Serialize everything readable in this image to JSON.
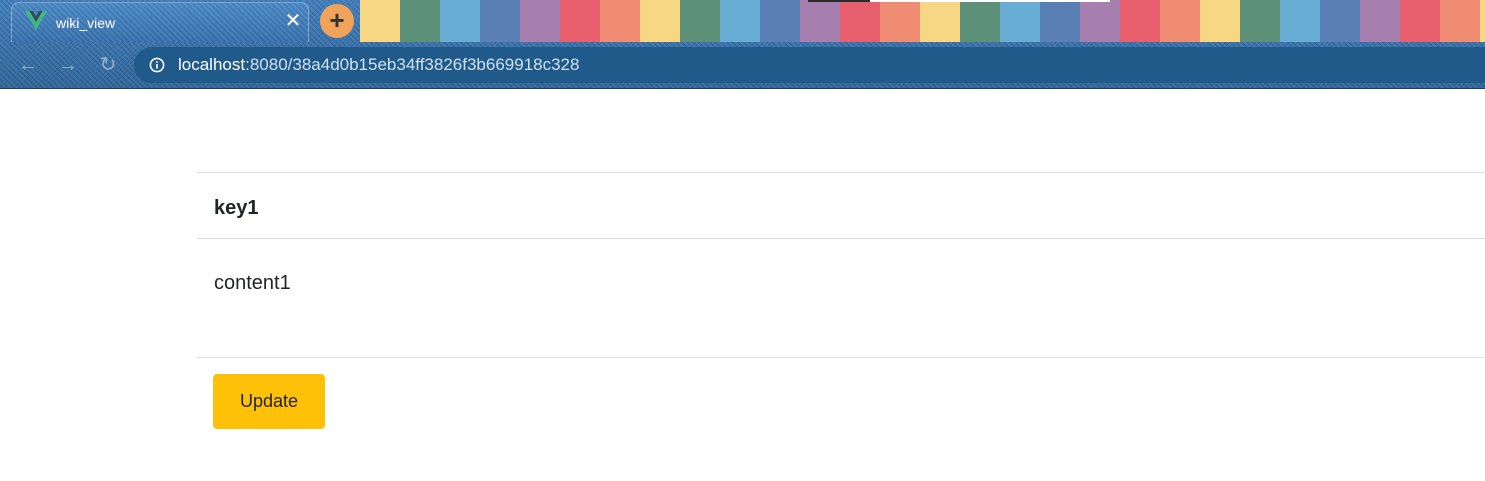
{
  "browser": {
    "tab": {
      "title": "wiki_view",
      "close_glyph": "✕",
      "favicon": "vue-logo-icon"
    },
    "new_tab_glyph": "+",
    "nav": {
      "back_glyph": "←",
      "forward_glyph": "→",
      "reload_glyph": "↻"
    },
    "address": {
      "host": "localhost",
      "path": ":8080/38a4d0b15eb34ff3826f3b669918c328"
    },
    "stripe_colors": [
      "#f7d783",
      "#5c9079",
      "#68add3",
      "#5a7fb5",
      "#a67fae",
      "#e85f6e",
      "#f08c74"
    ]
  },
  "page": {
    "title": "key1",
    "content": "content1",
    "update_label": "Update"
  },
  "colors": {
    "update_button": "#ffc107",
    "text": "#212529"
  }
}
